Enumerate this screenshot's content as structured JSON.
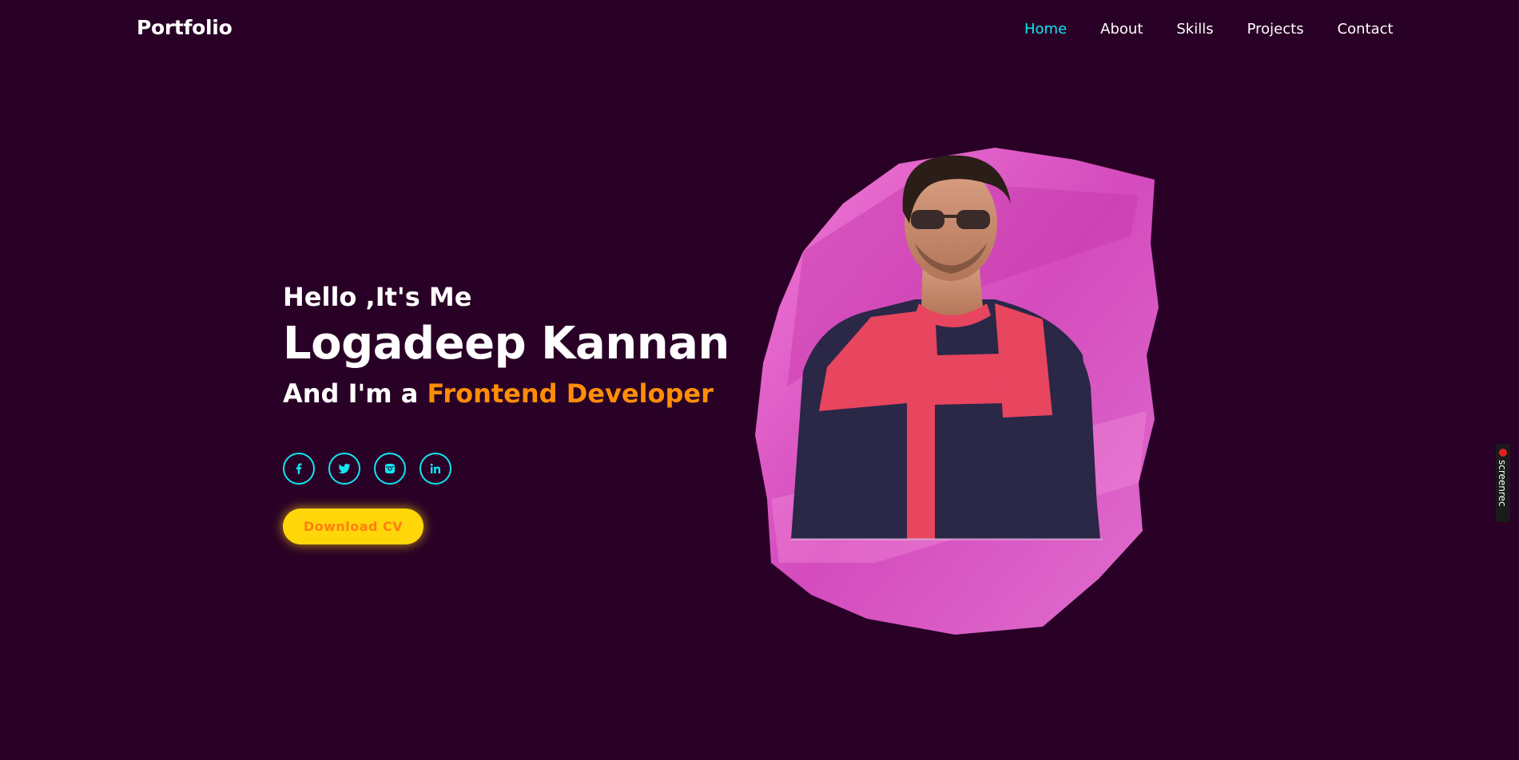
{
  "header": {
    "logo": "Portfolio",
    "nav": [
      {
        "label": "Home",
        "active": true
      },
      {
        "label": "About",
        "active": false
      },
      {
        "label": "Skills",
        "active": false
      },
      {
        "label": "Projects",
        "active": false
      },
      {
        "label": "Contact",
        "active": false
      }
    ]
  },
  "hero": {
    "greeting": "Hello ,It's Me",
    "name": "Logadeep Kannan",
    "role_prefix": "And I'm a ",
    "role_highlight": "Frontend Developer",
    "social": [
      {
        "icon": "facebook-icon"
      },
      {
        "icon": "twitter-icon"
      },
      {
        "icon": "instagram-icon"
      },
      {
        "icon": "linkedin-icon"
      }
    ],
    "cta_label": "Download CV"
  },
  "overlay": {
    "screenrec_label": "screenrec"
  },
  "colors": {
    "background": "#290026",
    "accent_cyan": "#12e6f2",
    "accent_orange": "#ff8d07",
    "button_yellow": "#ffd60a",
    "brush_pink": "#d94fc0"
  }
}
